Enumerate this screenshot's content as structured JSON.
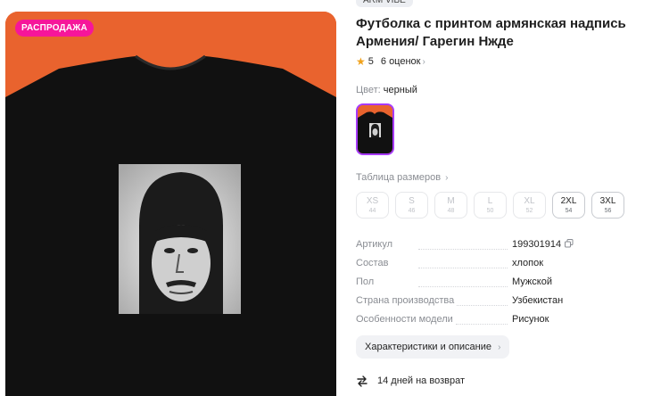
{
  "product": {
    "badge": "РАСПРОДАЖА",
    "brand": "ARM VIBE",
    "title": "Футболка с принтом армянская надпись Армения/ Гарегин Нжде",
    "rating": "5",
    "reviews": "6 оценок"
  },
  "color": {
    "label": "Цвет:",
    "value": "черный"
  },
  "size_table_label": "Таблица размеров",
  "sizes": [
    {
      "label": "XS",
      "num": "44",
      "available": false
    },
    {
      "label": "S",
      "num": "46",
      "available": false
    },
    {
      "label": "M",
      "num": "48",
      "available": false
    },
    {
      "label": "L",
      "num": "50",
      "available": false
    },
    {
      "label": "XL",
      "num": "52",
      "available": false
    },
    {
      "label": "2XL",
      "num": "54",
      "available": true
    },
    {
      "label": "3XL",
      "num": "56",
      "available": true
    }
  ],
  "specs": [
    {
      "key": "Артикул",
      "value": "199301914"
    },
    {
      "key": "Состав",
      "value": "хлопок"
    },
    {
      "key": "Пол",
      "value": "Мужской"
    },
    {
      "key": "Страна производства",
      "value": "Узбекистан"
    },
    {
      "key": "Особенности модели",
      "value": "Рисунок"
    }
  ],
  "details_button": "Характеристики и описание",
  "returns": "14 дней на возврат",
  "colors": {
    "badge": "#f6169a",
    "background": "#e9632e",
    "selected": "#a73afd"
  }
}
